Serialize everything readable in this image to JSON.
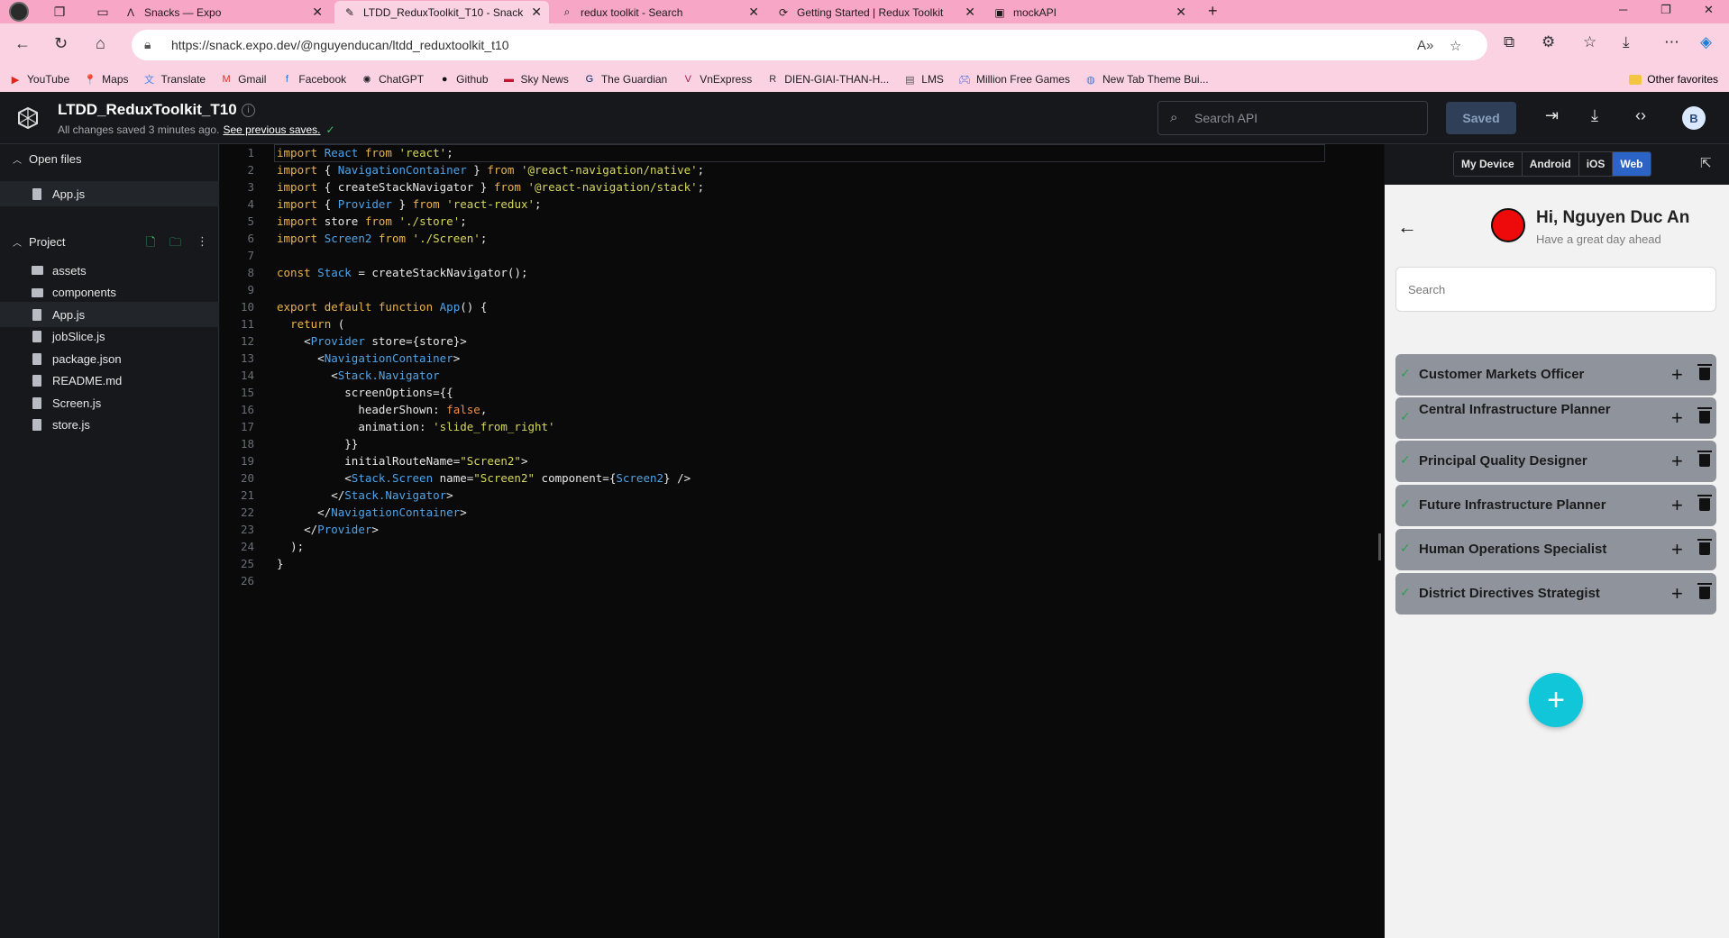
{
  "browser": {
    "tabs": [
      {
        "title": "Snacks — Expo",
        "icon": "expo-icon",
        "active": false
      },
      {
        "title": "LTDD_ReduxToolkit_T10 - Snack",
        "icon": "snack-icon",
        "active": true
      },
      {
        "title": "redux toolkit - Search",
        "icon": "search-icon",
        "active": false
      },
      {
        "title": "Getting Started | Redux Toolkit",
        "icon": "redux-icon",
        "active": false
      },
      {
        "title": "mockAPI",
        "icon": "api-icon",
        "active": false
      }
    ],
    "url": "https://snack.expo.dev/@nguyenducan/ltdd_reduxtoolkit_t10",
    "bookmarks": [
      {
        "label": "YouTube",
        "icon": "youtube-icon",
        "color": "#e62117"
      },
      {
        "label": "Maps",
        "icon": "maps-icon",
        "color": "#1a73e8"
      },
      {
        "label": "Translate",
        "icon": "translate-icon",
        "color": "#4285f4"
      },
      {
        "label": "Gmail",
        "icon": "gmail-icon",
        "color": "#d93025"
      },
      {
        "label": "Facebook",
        "icon": "facebook-icon",
        "color": "#1877f2"
      },
      {
        "label": "ChatGPT",
        "icon": "chatgpt-icon",
        "color": "#222222"
      },
      {
        "label": "Github",
        "icon": "github-icon",
        "color": "#111111"
      },
      {
        "label": "Sky News",
        "icon": "skynews-icon",
        "color": "#c4122f"
      },
      {
        "label": "The Guardian",
        "icon": "guardian-icon",
        "color": "#052962"
      },
      {
        "label": "VnExpress",
        "icon": "vnexpress-icon",
        "color": "#9f224e"
      },
      {
        "label": "DIEN-GIAI-THAN-H...",
        "icon": "doc-icon",
        "color": "#333333"
      },
      {
        "label": "LMS",
        "icon": "lms-icon",
        "color": "#555555"
      },
      {
        "label": "Million Free Games",
        "icon": "game-icon",
        "color": "#3b5bdb"
      },
      {
        "label": "New Tab Theme Bui...",
        "icon": "theme-icon",
        "color": "#3b7bdb"
      }
    ],
    "other_favorites": "Other favorites"
  },
  "snack": {
    "title": "LTDD_ReduxToolkit_T10",
    "status": "All changes saved 3 minutes ago.",
    "see_previous": "See previous saves.",
    "search_placeholder": "Search API",
    "saved_label": "Saved",
    "avatar_initial": "B"
  },
  "sidebar": {
    "open_files_label": "Open files",
    "open_files": [
      "App.js"
    ],
    "project_label": "Project",
    "project_items": [
      {
        "name": "assets",
        "type": "folder"
      },
      {
        "name": "components",
        "type": "folder"
      },
      {
        "name": "App.js",
        "type": "file",
        "active": true
      },
      {
        "name": "jobSlice.js",
        "type": "file"
      },
      {
        "name": "package.json",
        "type": "file"
      },
      {
        "name": "README.md",
        "type": "file"
      },
      {
        "name": "Screen.js",
        "type": "file"
      },
      {
        "name": "store.js",
        "type": "file"
      }
    ]
  },
  "code": {
    "lines": [
      "import React from 'react';",
      "import { NavigationContainer } from '@react-navigation/native';",
      "import { createStackNavigator } from '@react-navigation/stack';",
      "import { Provider } from 'react-redux';",
      "import store from './store';",
      "import Screen2 from './Screen';",
      "",
      "const Stack = createStackNavigator();",
      "",
      "export default function App() {",
      "  return (",
      "    <Provider store={store}>",
      "      <NavigationContainer>",
      "        <Stack.Navigator",
      "          screenOptions={{",
      "            headerShown: false,",
      "            animation: 'slide_from_right'",
      "          }}",
      "          initialRouteName=\"Screen2\">",
      "          <Stack.Screen name=\"Screen2\" component={Screen2} />",
      "        </Stack.Navigator>",
      "      </NavigationContainer>",
      "    </Provider>",
      "  );",
      "}",
      ""
    ]
  },
  "preview": {
    "device_tabs": [
      "My Device",
      "Android",
      "iOS",
      "Web"
    ],
    "active_tab": "Web",
    "app": {
      "greeting": "Hi, Nguyen Duc An",
      "subtitle": "Have a great day ahead",
      "search_placeholder": "Search",
      "jobs": [
        "Customer Markets Officer",
        "Central Infrastructure Planner",
        "Principal Quality Designer",
        "Future Infrastructure Planner",
        "Human Operations Specialist",
        "District Directives Strategist"
      ],
      "fab_label": "+"
    }
  },
  "colors": {
    "browser_tabbar": "#f8a6c6",
    "browser_toolbar": "#fbd2e2",
    "editor_bg": "#0a0a0a",
    "keyword": "#e8b34c",
    "identifier": "#4fa3e8",
    "string": "#d6d85b",
    "fab": "#11c6d9",
    "job_card": "#8f949c",
    "avatar_red": "#ee0a0a"
  }
}
